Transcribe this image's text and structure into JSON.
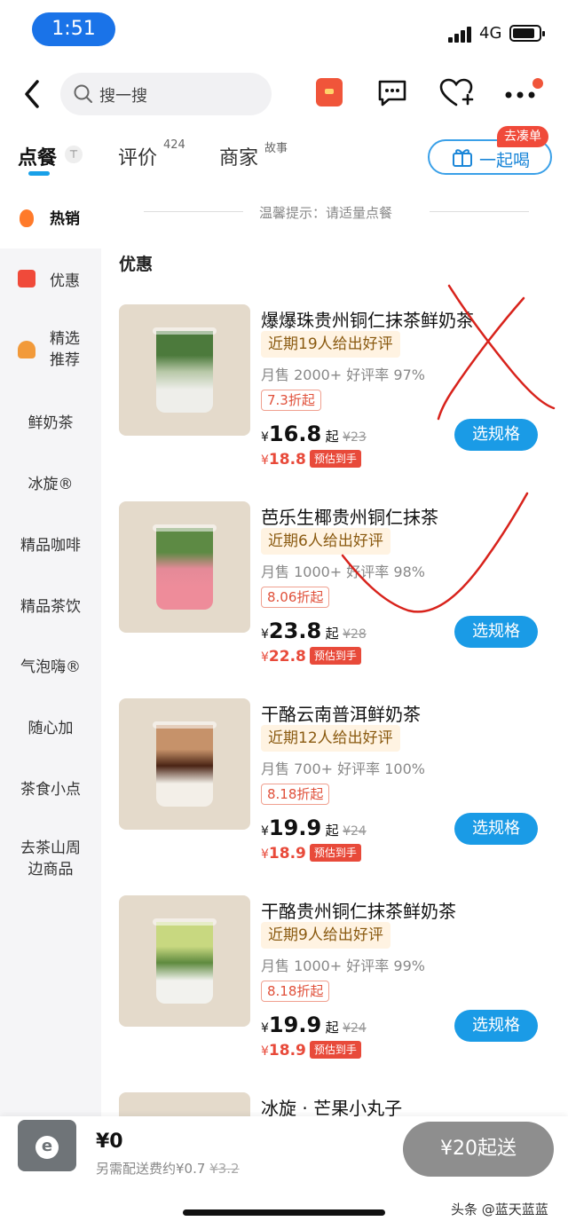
{
  "status_bar": {
    "time": "1:51",
    "network": "4G"
  },
  "search": {
    "placeholder": "搜一搜"
  },
  "tabs": [
    {
      "label": "点餐",
      "sup": ""
    },
    {
      "label": "评价",
      "sup": "424"
    },
    {
      "label": "商家",
      "sup": "故事"
    }
  ],
  "group_order": {
    "label": "一起喝",
    "badge": "去凑单"
  },
  "tip": "温馨提示：请适量点餐",
  "section_title": "优惠",
  "sidebar": [
    {
      "label": "热销"
    },
    {
      "label": "优惠"
    },
    {
      "label": "精选\n推荐"
    },
    {
      "label": "鲜奶茶"
    },
    {
      "label": "冰旋®"
    },
    {
      "label": "精品咖啡"
    },
    {
      "label": "精品茶饮"
    },
    {
      "label": "气泡嗨®"
    },
    {
      "label": "随心加"
    },
    {
      "label": "茶食小点"
    },
    {
      "label": "去茶山周\n边商品"
    }
  ],
  "products": [
    {
      "name": "爆爆珠贵州铜仁抹茶鲜奶茶",
      "review": "近期19人给出好评",
      "sales": "月售 2000+ 好评率 97%",
      "discount": "7.3折起",
      "price": "16.8",
      "price_suffix": "起",
      "orig_price": "¥23",
      "est_price": "18.8",
      "est_tag": "预估到手",
      "spec_label": "选规格",
      "cup_top": "#4c7a3c",
      "cup_mid": "#b8c8a8",
      "cup_bot": "#eeeeea"
    },
    {
      "name": "芭乐生椰贵州铜仁抹茶",
      "review": "近期6人给出好评",
      "sales": "月售 1000+ 好评率 98%",
      "discount": "8.06折起",
      "price": "23.8",
      "price_suffix": "起",
      "orig_price": "¥28",
      "est_price": "22.8",
      "est_tag": "预估到手",
      "spec_label": "选规格",
      "cup_top": "#5d8a44",
      "cup_mid": "#e48a98",
      "cup_bot": "#ee8c9a"
    },
    {
      "name": "干酪云南普洱鲜奶茶",
      "review": "近期12人给出好评",
      "sales": "月售 700+ 好评率 100%",
      "discount": "8.18折起",
      "price": "19.9",
      "price_suffix": "起",
      "orig_price": "¥24",
      "est_price": "18.9",
      "est_tag": "预估到手",
      "spec_label": "选规格",
      "cup_top": "#c6926a",
      "cup_mid": "#4a2414",
      "cup_bot": "#f3efe8"
    },
    {
      "name": "干酪贵州铜仁抹茶鲜奶茶",
      "review": "近期9人给出好评",
      "sales": "月售 1000+ 好评率 99%",
      "discount": "8.18折起",
      "price": "19.9",
      "price_suffix": "起",
      "orig_price": "¥24",
      "est_price": "18.9",
      "est_tag": "预估到手",
      "spec_label": "选规格",
      "cup_top": "#c8d880",
      "cup_mid": "#5e8a3e",
      "cup_bot": "#f2f2ee"
    },
    {
      "name": "冰旋 · 芒果小丸子"
    }
  ],
  "cart": {
    "total": "¥0",
    "fee_text": "另需配送费约¥0.7",
    "fee_orig": "¥3.2",
    "checkout_label": "¥20起送"
  },
  "watermark": "头条 @蓝天蓝蓝",
  "colors": {
    "accent": "#1a9be6",
    "price_red": "#e84a3a",
    "annotation_red": "#d8231c"
  }
}
